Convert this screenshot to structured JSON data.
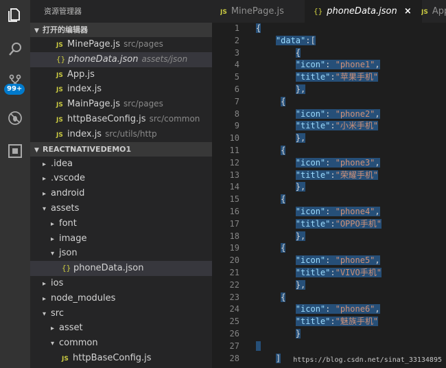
{
  "sidebar": {
    "title": "资源管理器",
    "open_editors_header": "打开的编辑器",
    "open_editors": [
      {
        "icon": "js-icon",
        "name": "MinePage.js",
        "path": "src/pages",
        "selected": false,
        "italic": false
      },
      {
        "icon": "json-icon",
        "name": "phoneData.json",
        "path": "assets/json",
        "selected": true,
        "italic": true
      },
      {
        "icon": "js-icon",
        "name": "App.js",
        "path": "",
        "selected": false,
        "italic": false
      },
      {
        "icon": "js-icon",
        "name": "index.js",
        "path": "",
        "selected": false,
        "italic": false
      },
      {
        "icon": "js-icon",
        "name": "MainPage.js",
        "path": "src/pages",
        "selected": false,
        "italic": false
      },
      {
        "icon": "js-icon",
        "name": "httpBaseConfig.js",
        "path": "src/common",
        "selected": false,
        "italic": false
      },
      {
        "icon": "js-icon",
        "name": "index.js",
        "path": "src/utils/http",
        "selected": false,
        "italic": false
      }
    ],
    "project_header": "REACTNATIVEDEMO1",
    "tree": [
      {
        "label": ".idea",
        "depth": 0,
        "expanded": false,
        "type": "folder"
      },
      {
        "label": ".vscode",
        "depth": 0,
        "expanded": false,
        "type": "folder"
      },
      {
        "label": "android",
        "depth": 0,
        "expanded": false,
        "type": "folder"
      },
      {
        "label": "assets",
        "depth": 0,
        "expanded": true,
        "type": "folder"
      },
      {
        "label": "font",
        "depth": 1,
        "expanded": false,
        "type": "folder"
      },
      {
        "label": "image",
        "depth": 1,
        "expanded": false,
        "type": "folder"
      },
      {
        "label": "json",
        "depth": 1,
        "expanded": true,
        "type": "folder"
      },
      {
        "label": "phoneData.json",
        "depth": 2,
        "type": "json",
        "selected": true
      },
      {
        "label": "ios",
        "depth": 0,
        "expanded": false,
        "type": "folder"
      },
      {
        "label": "node_modules",
        "depth": 0,
        "expanded": false,
        "type": "folder"
      },
      {
        "label": "src",
        "depth": 0,
        "expanded": true,
        "type": "folder"
      },
      {
        "label": "asset",
        "depth": 1,
        "expanded": false,
        "type": "folder"
      },
      {
        "label": "common",
        "depth": 1,
        "expanded": true,
        "type": "folder"
      },
      {
        "label": "httpBaseConfig.js",
        "depth": 2,
        "type": "js"
      }
    ]
  },
  "activity": {
    "badge": "99+"
  },
  "tabs": [
    {
      "icon": "JS",
      "label": "MinePage.js",
      "active": false
    },
    {
      "icon": "{}",
      "label": "phoneData.json",
      "active": true,
      "close": "×"
    },
    {
      "icon": "JS",
      "label": "App.js",
      "active": false
    }
  ],
  "code": {
    "line_numbers": [
      "1",
      "2",
      "3",
      "4",
      "5",
      "6",
      "7",
      "8",
      "9",
      "10",
      "11",
      "12",
      "13",
      "14",
      "15",
      "16",
      "17",
      "18",
      "19",
      "20",
      "21",
      "22",
      "23",
      "24",
      "25",
      "26",
      "27",
      "28"
    ],
    "phones": [
      {
        "icon": "phone1",
        "title": "苹果手机"
      },
      {
        "icon": "phone2",
        "title": "小米手机"
      },
      {
        "icon": "phone3",
        "title": "荣耀手机"
      },
      {
        "icon": "phone4",
        "title": "OPPO手机"
      },
      {
        "icon": "phone5",
        "title": "VIVO手机"
      },
      {
        "icon": "phone6",
        "title": "魅族手机"
      }
    ]
  },
  "watermark": "https://blog.csdn.net/sinat_33134895",
  "colors": {
    "activity": "#333333",
    "sidebar": "#252526",
    "editor": "#1e1e1e",
    "selection": "#264f78",
    "key": "#9cdcfe",
    "string": "#ce9178",
    "accent": "#007acc"
  }
}
